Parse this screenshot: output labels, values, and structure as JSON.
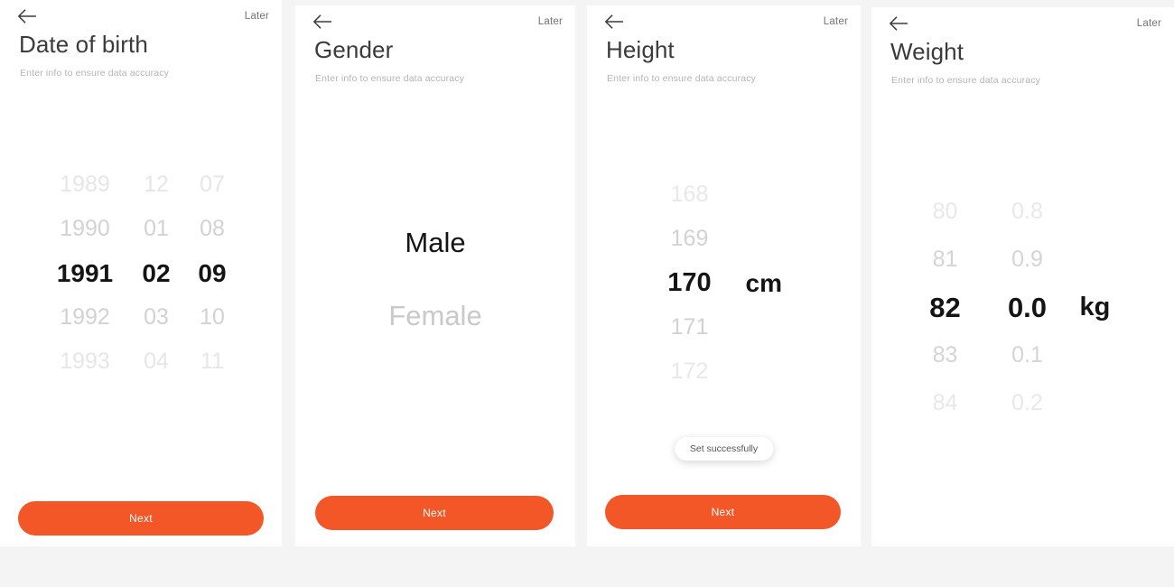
{
  "common": {
    "later_label": "Later",
    "back_icon": "arrow-left-icon",
    "subtitle": "Enter info to ensure data accuracy",
    "next_label": "Next",
    "accent_color": "#f35627",
    "page_background": "#f4f4f4",
    "panel_background": "#ffffff"
  },
  "panels": [
    {
      "id": "date-of-birth",
      "title": "Date of birth",
      "subtitle": "Enter info to ensure data accuracy",
      "later_label": "Later",
      "next_label": "Next",
      "picker": {
        "type": "date",
        "columns": [
          "year",
          "month",
          "day"
        ],
        "selected": {
          "year": "1991",
          "month": "02",
          "day": "09"
        },
        "rows": [
          {
            "year": "1989",
            "month": "12",
            "day": "07",
            "state": "far"
          },
          {
            "year": "1990",
            "month": "01",
            "day": "08",
            "state": "near"
          },
          {
            "year": "1991",
            "month": "02",
            "day": "09",
            "state": "selected"
          },
          {
            "year": "1992",
            "month": "03",
            "day": "10",
            "state": "near"
          },
          {
            "year": "1993",
            "month": "04",
            "day": "11",
            "state": "far"
          }
        ]
      }
    },
    {
      "id": "gender",
      "title": "Gender",
      "subtitle": "Enter info to ensure data accuracy",
      "later_label": "Later",
      "next_label": "Next",
      "picker": {
        "type": "option",
        "selected": "Male",
        "rows": [
          {
            "label": "Male",
            "state": "selected"
          },
          {
            "label": "Female",
            "state": "far"
          }
        ]
      }
    },
    {
      "id": "height",
      "title": "Height",
      "subtitle": "Enter info to ensure data accuracy",
      "later_label": "Later",
      "next_label": "Next",
      "toast": "Set successfully",
      "picker": {
        "type": "number",
        "unit": "cm",
        "selected": "170",
        "rows": [
          {
            "value": "168",
            "unit": "",
            "state": "far"
          },
          {
            "value": "169",
            "unit": "",
            "state": "near"
          },
          {
            "value": "170",
            "unit": "cm",
            "state": "selected"
          },
          {
            "value": "171",
            "unit": "",
            "state": "near"
          },
          {
            "value": "172",
            "unit": "",
            "state": "far"
          }
        ]
      }
    },
    {
      "id": "weight",
      "title": "Weight",
      "subtitle": "Enter info to ensure data accuracy",
      "later_label": "Later",
      "picker": {
        "type": "number-decimal",
        "unit": "kg",
        "selected": {
          "integer": "82",
          "decimal": "0.0"
        },
        "rows": [
          {
            "integer": "80",
            "decimal": "0.8",
            "unit": "",
            "state": "far"
          },
          {
            "integer": "81",
            "decimal": "0.9",
            "unit": "",
            "state": "near"
          },
          {
            "integer": "82",
            "decimal": "0.0",
            "unit": "kg",
            "state": "selected"
          },
          {
            "integer": "83",
            "decimal": "0.1",
            "unit": "",
            "state": "near"
          },
          {
            "integer": "84",
            "decimal": "0.2",
            "unit": "",
            "state": "far"
          }
        ]
      }
    }
  ]
}
